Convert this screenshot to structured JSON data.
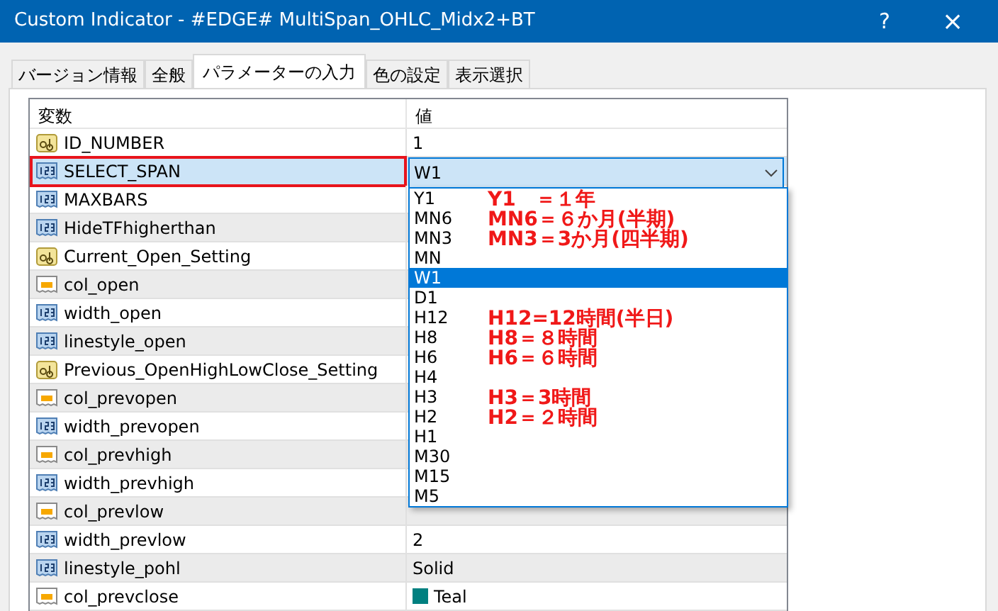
{
  "window": {
    "title": "Custom Indicator - #EDGE# MultiSpan_OHLC_Midx2+BT",
    "help": "?",
    "close": "×"
  },
  "tabs": [
    {
      "label": "バージョン情報",
      "selected": false
    },
    {
      "label": "全般",
      "selected": false
    },
    {
      "label": "パラメーターの入力",
      "selected": true
    },
    {
      "label": "色の設定",
      "selected": false
    },
    {
      "label": "表示選択",
      "selected": false
    }
  ],
  "grid": {
    "columns": [
      "変数",
      "値"
    ],
    "rows": [
      {
        "kind": "string",
        "name": "ID_NUMBER",
        "value": "1",
        "selected": false
      },
      {
        "kind": "int",
        "name": "SELECT_SPAN",
        "value": "W1",
        "selected": true,
        "highlighted": true
      },
      {
        "kind": "int",
        "name": "MAXBARS",
        "selected": false
      },
      {
        "kind": "int",
        "name": "HideTFhigherthan",
        "selected": false
      },
      {
        "kind": "string",
        "name": "Current_Open_Setting",
        "selected": false
      },
      {
        "kind": "color",
        "name": "col_open",
        "selected": false
      },
      {
        "kind": "int",
        "name": "width_open",
        "selected": false
      },
      {
        "kind": "int",
        "name": "linestyle_open",
        "selected": false
      },
      {
        "kind": "string",
        "name": "Previous_OpenHighLowClose_Setting",
        "selected": false
      },
      {
        "kind": "color",
        "name": "col_prevopen",
        "selected": false
      },
      {
        "kind": "int",
        "name": "width_prevopen",
        "selected": false
      },
      {
        "kind": "color",
        "name": "col_prevhigh",
        "selected": false
      },
      {
        "kind": "int",
        "name": "width_prevhigh",
        "selected": false
      },
      {
        "kind": "color",
        "name": "col_prevlow",
        "selected": false
      },
      {
        "kind": "int",
        "name": "width_prevlow",
        "value": "2",
        "selected": false
      },
      {
        "kind": "int",
        "name": "linestyle_pohl",
        "value": "Solid",
        "selected": false
      },
      {
        "kind": "color",
        "name": "col_prevclose",
        "value": "Teal",
        "color": "#008080",
        "selected": false
      }
    ]
  },
  "dropdown": {
    "options": [
      {
        "label": "Y1",
        "selected": false,
        "note": "Y1　＝１年"
      },
      {
        "label": "MN6",
        "selected": false,
        "note": "MN6＝６か月(半期)"
      },
      {
        "label": "MN3",
        "selected": false,
        "note": "MN3＝3か月(四半期)"
      },
      {
        "label": "MN",
        "selected": false
      },
      {
        "label": "W1",
        "selected": true
      },
      {
        "label": "D1",
        "selected": false
      },
      {
        "label": "H12",
        "selected": false,
        "note": "H12=12時間(半日)"
      },
      {
        "label": "H8",
        "selected": false,
        "note": "H8＝８時間"
      },
      {
        "label": "H6",
        "selected": false,
        "note": "H6＝６時間"
      },
      {
        "label": "H4",
        "selected": false
      },
      {
        "label": "H3",
        "selected": false,
        "note": "H3＝3時間"
      },
      {
        "label": "H2",
        "selected": false,
        "note": "H2＝２時間"
      },
      {
        "label": "H1",
        "selected": false
      },
      {
        "label": "M30",
        "selected": false
      },
      {
        "label": "M15",
        "selected": false
      },
      {
        "label": "M5",
        "selected": false
      }
    ]
  }
}
